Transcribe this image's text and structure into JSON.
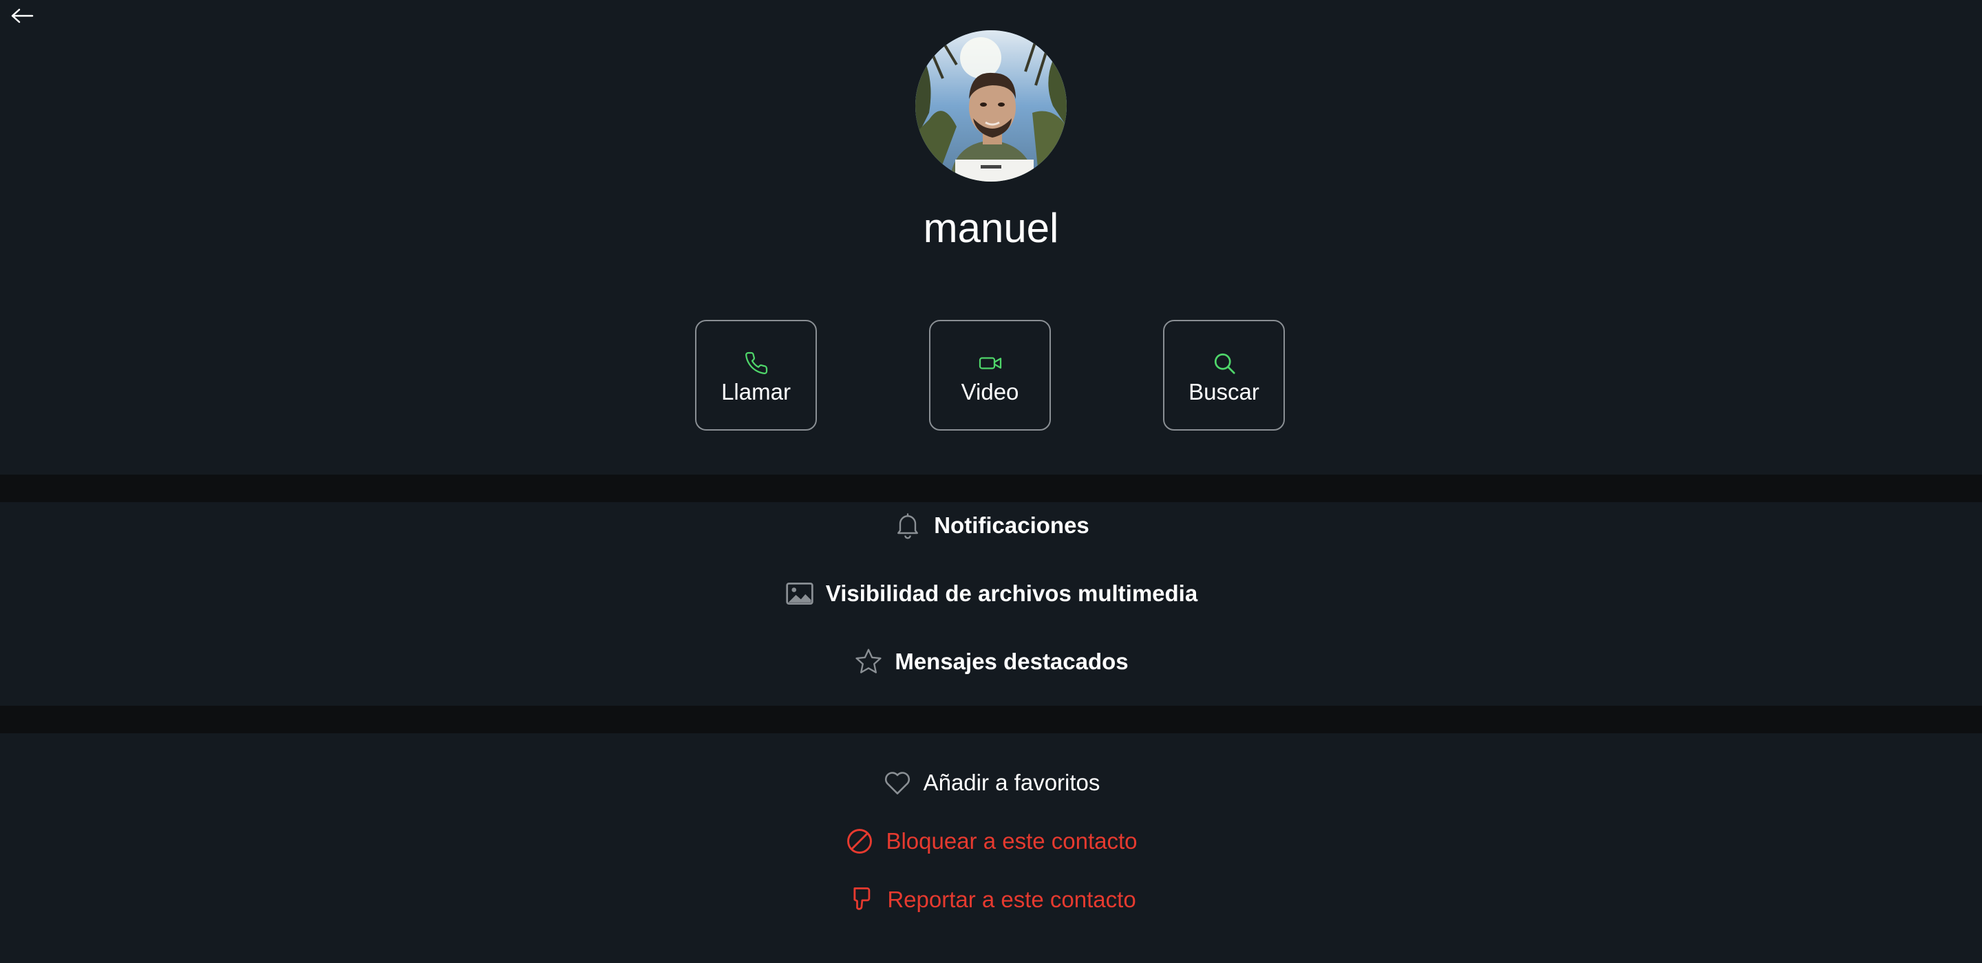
{
  "header": {
    "back_icon": "arrow-left-icon"
  },
  "contact": {
    "name": "manuel",
    "avatar": "profile-photo"
  },
  "actions": [
    {
      "label": "Llamar",
      "icon": "phone-icon"
    },
    {
      "label": "Video",
      "icon": "video-camera-icon"
    },
    {
      "label": "Buscar",
      "icon": "search-icon"
    }
  ],
  "settings": [
    {
      "label": "Notificaciones",
      "icon": "bell-icon"
    },
    {
      "label": "Visibilidad de archivos multimedia",
      "icon": "image-icon"
    },
    {
      "label": "Mensajes destacados",
      "icon": "star-icon"
    }
  ],
  "contact_options": [
    {
      "label": "Añadir a favoritos",
      "icon": "heart-icon"
    },
    {
      "label": "Bloquear a este contacto",
      "icon": "block-icon"
    },
    {
      "label": "Reportar a este contacto",
      "icon": "thumbs-down-icon"
    }
  ],
  "colors": {
    "background": "#141a20",
    "divider": "#0d0f11",
    "accent_green": "#4fd66a",
    "danger_red": "#e63a2f",
    "icon_gray": "#8a8f94",
    "text": "#ffffff"
  }
}
